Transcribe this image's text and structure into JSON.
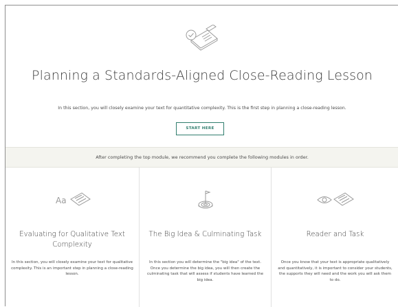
{
  "hero": {
    "icon": "document-check-pen-icon",
    "title": "Planning a Standards-Aligned Close-Reading Lesson",
    "description": "In this section, you will closely examine your text for quantitative complexity. This is the first step in planning a close-reading lesson.",
    "button_label": "START HERE"
  },
  "notice": {
    "text": "After completing the top module, we recommend you complete the following modules in order."
  },
  "modules": [
    {
      "icon": "text-aa-page-icon",
      "title": "Evaluating for Qualitative Text Complexity",
      "description": "In this section, you will closely examine your text for qualitative complexity. This is an important step in planning a close-reading lesson."
    },
    {
      "icon": "target-flag-icon",
      "title": "The Big Idea & Culminating Task",
      "description": "In this section you will determine the \"big idea\" of the text. Once you determine the big idea, you will then create the culminating task that will assess if students have learned the big idea."
    },
    {
      "icon": "eye-page-icon",
      "title": "Reader and Task",
      "description": "Once you know that your text is appropriate qualitatively and quantitatively, it is important to consider your students, the supports they will need and the work you will ask them to do."
    }
  ],
  "colors": {
    "accent": "#2f7d6d",
    "notice_bg": "#f4f4ef",
    "icon_stroke": "#9a9a9a"
  }
}
